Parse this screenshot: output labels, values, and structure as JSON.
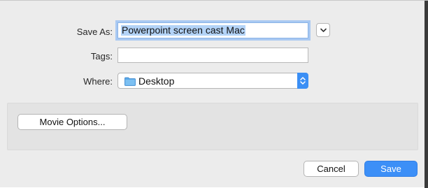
{
  "form": {
    "save_as_label": "Save As:",
    "save_as_value": "Powerpoint screen cast Mac",
    "tags_label": "Tags:",
    "tags_value": "",
    "where_label": "Where:",
    "where_value": "Desktop"
  },
  "options": {
    "movie_options_label": "Movie Options..."
  },
  "buttons": {
    "cancel_label": "Cancel",
    "save_label": "Save"
  },
  "icons": {
    "expand": "chevron-down-icon",
    "folder": "folder-icon",
    "popup_arrows": "up-down-arrows-icon"
  },
  "colors": {
    "accent": "#3c8ff7",
    "selection": "#b3d3f7",
    "dialog_background": "#ececec"
  }
}
